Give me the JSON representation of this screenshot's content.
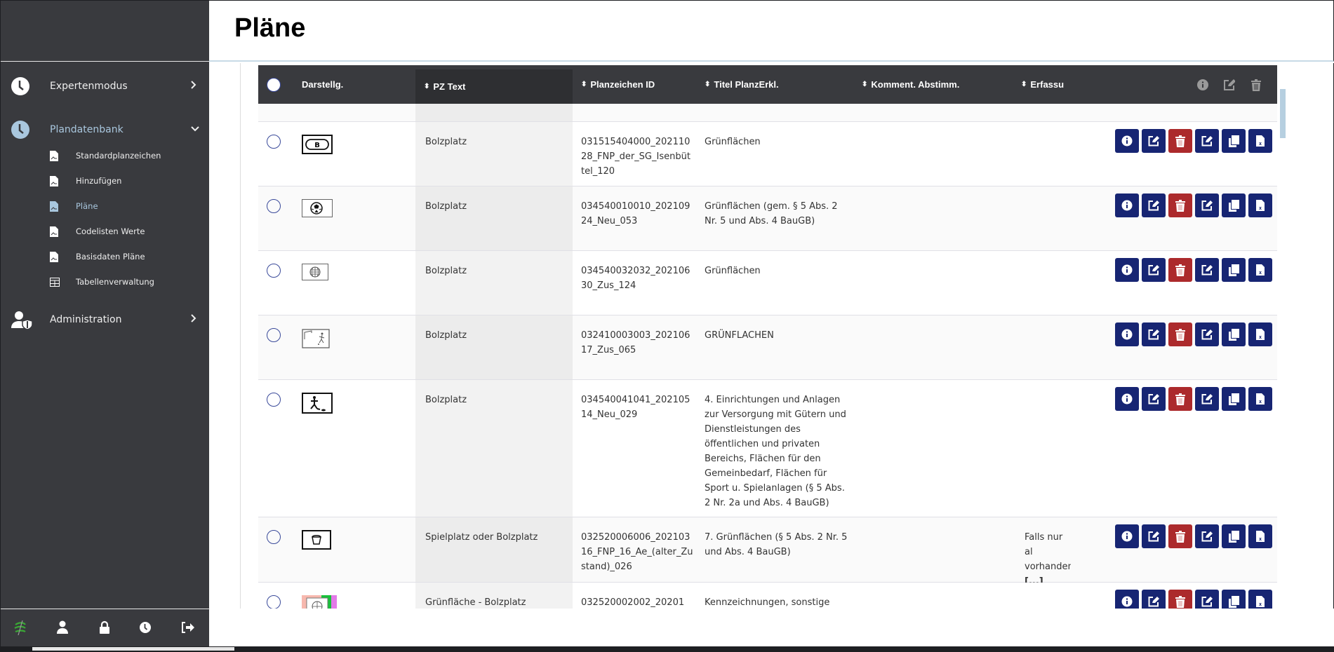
{
  "page": {
    "title": "Pläne"
  },
  "sidebar": {
    "items": [
      {
        "label": "Expertenmodus",
        "icon": "clock-icon",
        "expanded": false
      },
      {
        "label": "Plandatenbank",
        "icon": "clock-icon",
        "expanded": true,
        "active": true
      },
      {
        "label": "Administration",
        "icon": "user-shield-icon",
        "expanded": false
      }
    ],
    "subitems": [
      {
        "label": "Standardplanzeichen",
        "icon": "file-image-icon"
      },
      {
        "label": "Hinzufügen",
        "icon": "file-image-icon"
      },
      {
        "label": "Pläne",
        "icon": "file-image-icon",
        "active": true
      },
      {
        "label": "Codelisten Werte",
        "icon": "file-image-icon"
      },
      {
        "label": "Basisdaten Pläne",
        "icon": "file-image-icon"
      },
      {
        "label": "Tabellenverwaltung",
        "icon": "table-icon"
      }
    ],
    "footer_icons": [
      "logo-icon",
      "user-icon",
      "lock-icon",
      "clock-icon",
      "sign-out-icon"
    ]
  },
  "table": {
    "columns": {
      "symbol": "Darstellg.",
      "pz_text": "PZ Text",
      "planzeichen_id": "Planzeichen ID",
      "titel": "Titel PlanzErkl.",
      "komment": "Komment. Abstimm.",
      "erfassung": "Erfassu"
    },
    "header_actions": [
      "info-icon",
      "edit-icon",
      "trash-icon"
    ],
    "row_actions": [
      "info",
      "edit",
      "delete",
      "edit-plan",
      "copy",
      "export-excel"
    ],
    "rows": [
      {
        "symbol": "letter-b-symbol",
        "pz_text": "Bolzplatz",
        "planzeichen_id": "031515404000_20211028_FNP_der_SG_Isenbüttel_120",
        "titel": "Grünflächen",
        "komment": "",
        "erfassung": ""
      },
      {
        "symbol": "soccer-ball-symbol",
        "pz_text": "Bolzplatz",
        "planzeichen_id": "034540010010_20210924_Neu_053",
        "titel": "Grünflächen (gem. § 5 Abs. 2 Nr. 5 und Abs. 4 BauGB)",
        "komment": "",
        "erfassung": ""
      },
      {
        "symbol": "globe-grid-symbol",
        "pz_text": "Bolzplatz",
        "planzeichen_id": "034540032032_20210630_Zus_124",
        "titel": "Grünflächen",
        "komment": "",
        "erfassung": ""
      },
      {
        "symbol": "goal-player-symbol",
        "pz_text": "Bolzplatz",
        "planzeichen_id": "032410003003_20210617_Zus_065",
        "titel": "GRÜNFLACHEN",
        "komment": "",
        "erfassung": ""
      },
      {
        "symbol": "kicking-player-symbol",
        "pz_text": "Bolzplatz",
        "planzeichen_id": "034540041041_20210514_Neu_029",
        "titel": "4. Einrichtungen und Anlagen zur Versorgung mit Gütern und Dienstleistungen des öffentlichen und privaten Bereichs, Flächen für den Gemeinbedarf, Flächen für Sport u. Spielanlagen (§ 5 Abs. 2 Nr. 2a und Abs. 4 BauGB)",
        "komment": "",
        "erfassung": ""
      },
      {
        "symbol": "bucket-symbol",
        "pz_text": "Spielplatz oder Bolzplatz",
        "planzeichen_id": "032520006006_20210316_FNP_16_Ae_(alter_Zustand)_026",
        "titel": "7. Grünflächen (§ 5 Abs. 2 Nr. 5 und Abs. 4 BauGB)",
        "komment": "",
        "erfassung": "Falls nur al vorhanden",
        "erfassung_more": "[...]"
      },
      {
        "symbol": "colored-map-globe-symbol",
        "pz_text": "Grünfläche - Bolzplatz",
        "planzeichen_id": "032520002002_20201",
        "titel": "Kennzeichnungen, sonstige",
        "komment": "",
        "erfassung": ""
      }
    ]
  },
  "colors": {
    "sidebar_bg": "#393a3e",
    "accent": "#a9c7de",
    "button_primary": "#172573",
    "button_danger": "#ac2a2c",
    "table_header": "#393a3e"
  }
}
